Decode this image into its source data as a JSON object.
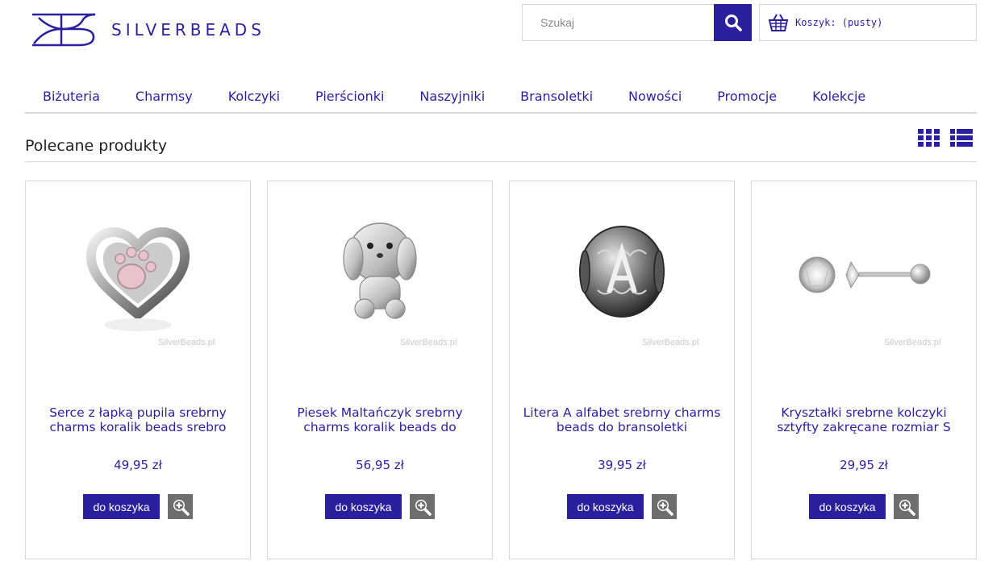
{
  "header": {
    "brand": "SILVERBEADS",
    "brand_color": "#2a1f9e",
    "search": {
      "placeholder": "Szukaj",
      "icon": "search-icon"
    },
    "cart": {
      "label": "Koszyk: (pusty)",
      "icon": "basket-icon"
    }
  },
  "menu": {
    "items": [
      {
        "label": "Biżuteria"
      },
      {
        "label": "Charmsy"
      },
      {
        "label": "Kolczyki"
      },
      {
        "label": "Pierścionki"
      },
      {
        "label": "Naszyjniki"
      },
      {
        "label": "Bransoletki"
      },
      {
        "label": "Nowości"
      },
      {
        "label": "Promocje"
      },
      {
        "label": "Kolekcje"
      }
    ]
  },
  "section": {
    "title": "Polecane produkty",
    "view_icons": [
      "grid-view-icon",
      "list-view-icon"
    ]
  },
  "products": [
    {
      "name": "Serce z łapką pupila srebrny charms koralik beads srebro",
      "price": "49,95 zł",
      "add_label": "do koszyka",
      "watermark": "SilverBeads.pl",
      "image": "heart-paw-charm"
    },
    {
      "name": "Piesek Maltańczyk srebrny charms koralik beads do",
      "price": "56,95 zł",
      "add_label": "do koszyka",
      "watermark": "SilverBeads.pl",
      "image": "maltese-dog-charm"
    },
    {
      "name": "Litera A alfabet srebrny charms beads do bransoletki",
      "price": "39,95 zł",
      "add_label": "do koszyka",
      "watermark": "SilverBeads.pl",
      "image": "letter-a-bead"
    },
    {
      "name": "Kryształki srebrne kolczyki sztyfty zakręcane rozmiar S",
      "price": "29,95 zł",
      "add_label": "do koszyka",
      "watermark": "SilverBeads.pl",
      "image": "crystal-stud-earrings"
    }
  ]
}
